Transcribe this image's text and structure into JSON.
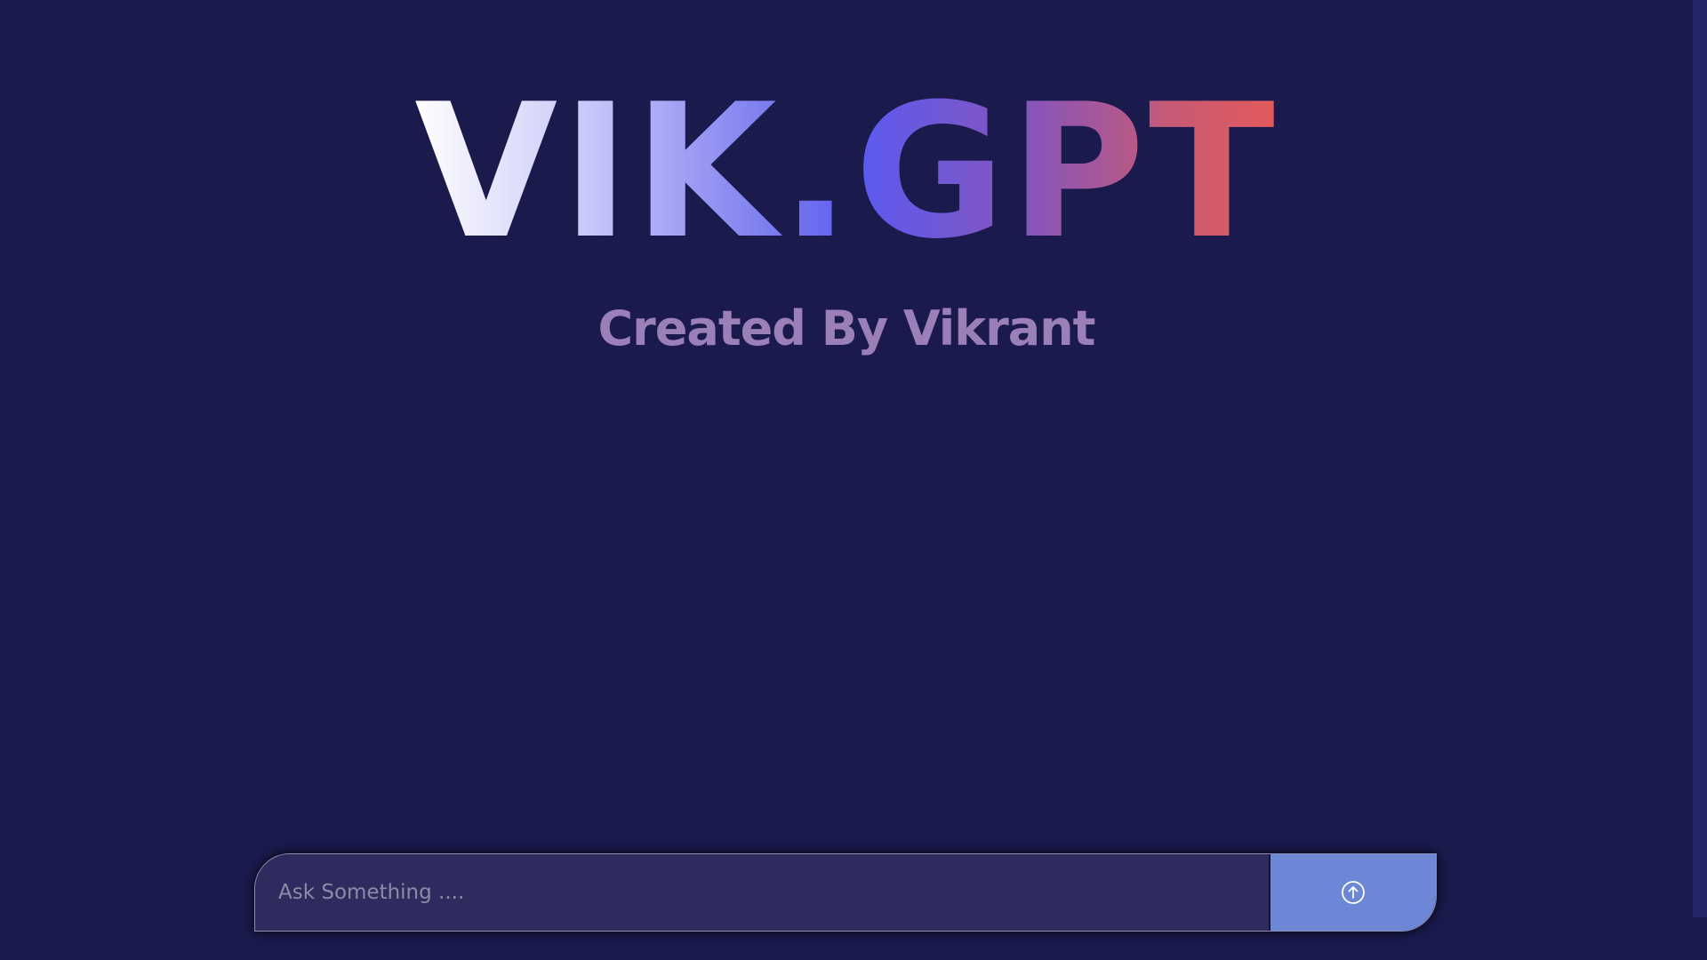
{
  "app": {
    "title": "VIK.GPT",
    "subtitle": "Created By Vikrant"
  },
  "prompt": {
    "placeholder": "Ask Something ....",
    "value": "",
    "send_icon": "arrow-up-circle-icon"
  },
  "colors": {
    "background": "#1a1a4d",
    "subtitle": "#9a7fb8",
    "input_background": "#2e2b5e",
    "send_button": "#6b87d6",
    "title_gradient": [
      "#ffffff",
      "#5b5aee",
      "#e25a5a"
    ]
  }
}
